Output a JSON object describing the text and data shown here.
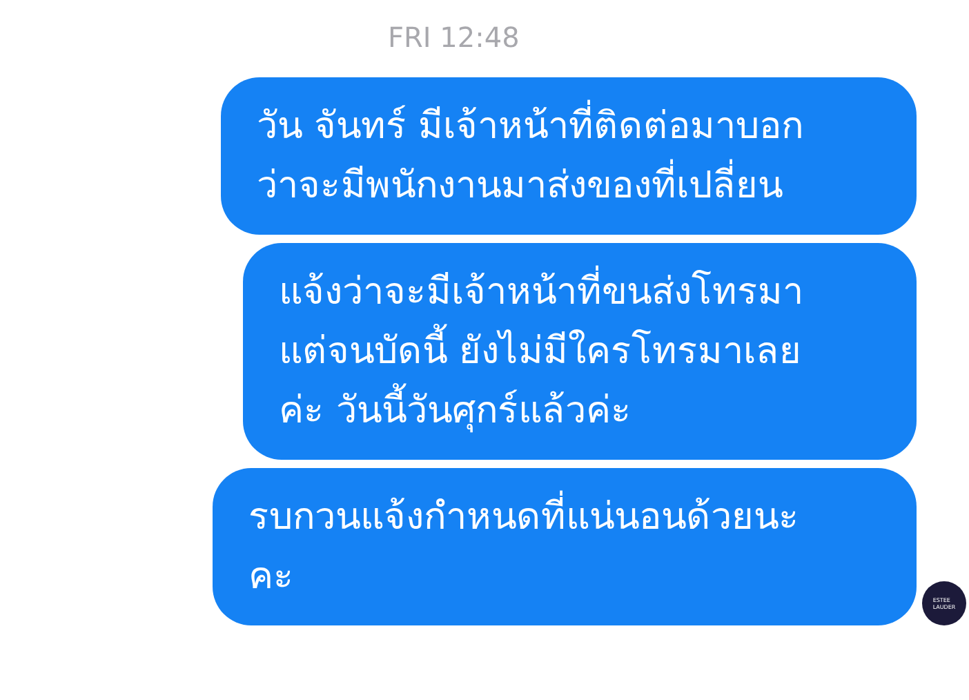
{
  "timestamp": "FRI 12:48",
  "messages": [
    {
      "lines": [
        "วัน จันทร์ มีเจ้าหน้าที่ติดต่อมาบอก",
        "ว่าจะมีพนักงานมาส่งของที่เปลี่ยน"
      ]
    },
    {
      "lines": [
        "แจ้งว่าจะมีเจ้าหน้าที่ขนส่งโทรมา",
        "แต่จนบัดนี้ ยังไม่มีใครโทรมาเลย",
        "ค่ะ วันนี้วันศุกร์แล้วค่ะ"
      ]
    },
    {
      "lines": [
        "รบกวนแจ้งกำหนดที่แน่นอนด้วยนะ",
        "คะ"
      ]
    }
  ],
  "avatar": {
    "lines": [
      "ESTEE",
      "LAUDER"
    ]
  }
}
